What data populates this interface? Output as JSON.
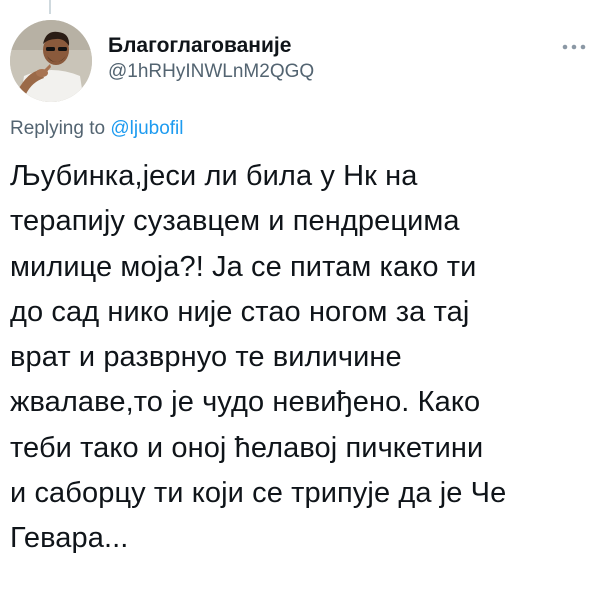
{
  "tweet": {
    "display_name": "Благоглагованије",
    "handle": "@1hRHyINWLnM2QGQ",
    "replying_prefix": "Replying to",
    "replying_to": "@ljubofil",
    "text_lines": [
      "Љубинка,јеси ли била у Нк на",
      "терапију сузавцем и пендрецима",
      "милице моја?! Ја се питам како ти",
      "до сад нико није стао ногом за тај",
      "врат и разврнуо те виличине",
      "жвалаве,то је чудо невиђено. Како",
      "теби тако и оној ћелавој пичкетини",
      "и саборцу ти који се трипује да је Че",
      "Гевара..."
    ]
  },
  "icons": {
    "avatar": "profile-photo",
    "more": "more-options-icon"
  },
  "colors": {
    "text": "#0f1419",
    "secondary": "#536471",
    "link": "#1d9bf0"
  }
}
